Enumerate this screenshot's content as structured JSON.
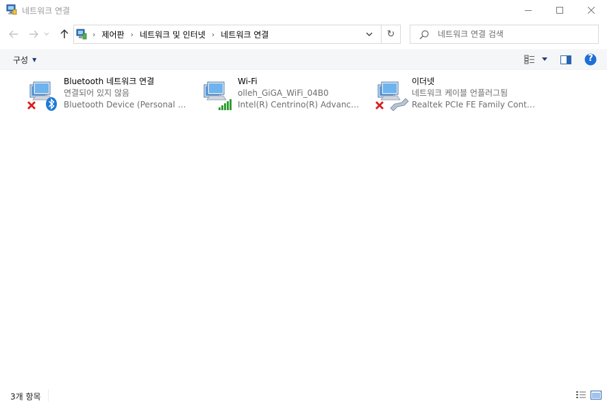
{
  "window": {
    "title": "네트워크 연결",
    "icon": "network-connections-icon",
    "minimize_icon": "minimize-icon",
    "maximize_icon": "maximize-icon",
    "close_icon": "close-icon"
  },
  "nav": {
    "back_icon": "arrow-left-icon",
    "forward_icon": "arrow-right-icon",
    "recent_icon": "chevron-down-icon",
    "up_icon": "arrow-up-icon"
  },
  "address": {
    "icon": "control-panel-icon",
    "crumbs": [
      "제어판",
      "네트워크 및 인터넷",
      "네트워크 연결"
    ],
    "separator": "›",
    "refresh_glyph": "↻"
  },
  "search": {
    "placeholder": "네트워크 연결 검색",
    "value": ""
  },
  "toolbar": {
    "organize_label": "구성",
    "organize_caret": "▼",
    "view_icon": "change-view-icon",
    "preview_pane_icon": "preview-pane-icon",
    "help_icon": "help-icon",
    "help_glyph": "?"
  },
  "connections": [
    {
      "name": "Bluetooth 네트워크 연결",
      "status": "연결되어 있지 않음",
      "device": "Bluetooth Device (Personal A...",
      "icon": "bluetooth-adapter-icon",
      "badge": "disconnected-x-icon"
    },
    {
      "name": "Wi-Fi",
      "status": "olleh_GiGA_WiFi_04B0",
      "device": "Intel(R) Centrino(R) Advance...",
      "icon": "wifi-adapter-icon",
      "badge": "signal-bars-icon"
    },
    {
      "name": "이더넷",
      "status": "네트워크 케이블 언플러그됨",
      "device": "Realtek PCIe FE Family Contr...",
      "icon": "ethernet-adapter-icon",
      "badge": "disconnected-x-icon"
    }
  ],
  "status": {
    "count": "3개 항목",
    "details_view_icon": "details-view-icon",
    "tiles_view_icon": "tiles-view-icon"
  },
  "colors": {
    "accent": "#1e7ad6",
    "error_red": "#d81e1e",
    "signal_green": "#2f9e2f",
    "muted_text": "#6d6d6d"
  }
}
